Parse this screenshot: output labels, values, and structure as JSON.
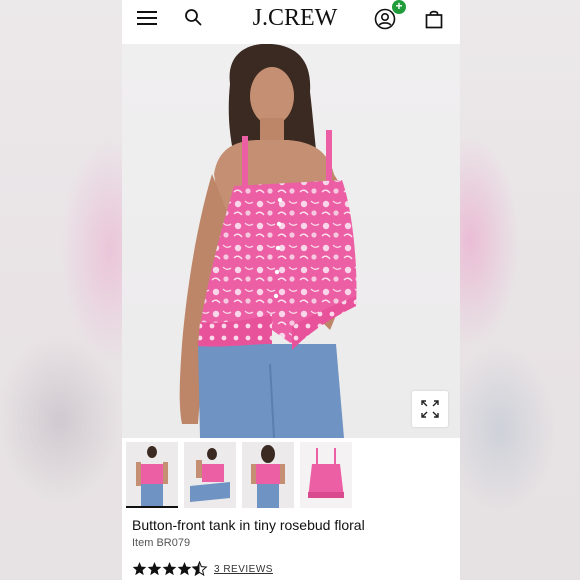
{
  "header": {
    "logo": "J.CREW",
    "menu_icon": "hamburger-menu-icon",
    "search_icon": "search-icon",
    "account_icon": "account-icon",
    "account_badge": "+",
    "bag_icon": "shopping-bag-icon"
  },
  "product": {
    "title": "Button-front tank in tiny rosebud floral",
    "item_number": "Item BR079",
    "rating": 4.5,
    "rating_max": 5,
    "reviews_label": "3 REVIEWS"
  },
  "thumbnails": [
    {
      "label": "front view",
      "selected": true
    },
    {
      "label": "seated view",
      "selected": false
    },
    {
      "label": "back view",
      "selected": false
    },
    {
      "label": "flat lay",
      "selected": false
    }
  ],
  "colors": {
    "accent_pink": "#ea5ba0",
    "badge_green": "#1f9d3a",
    "denim_blue": "#6f93c2"
  }
}
